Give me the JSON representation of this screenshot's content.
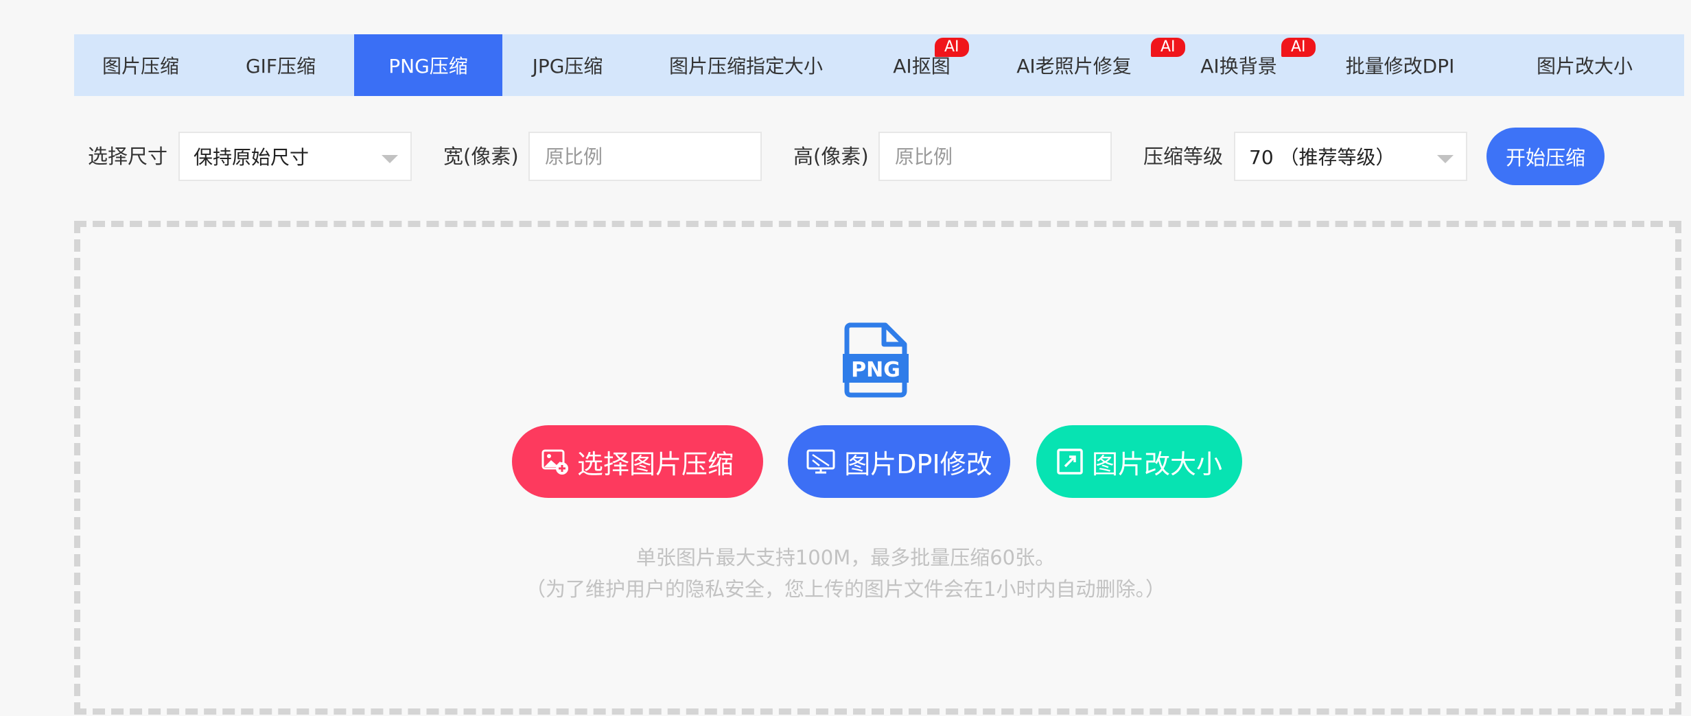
{
  "tabs": [
    {
      "label": "图片压缩",
      "active": false,
      "ai": false
    },
    {
      "label": "GIF压缩",
      "active": false,
      "ai": false
    },
    {
      "label": "PNG压缩",
      "active": true,
      "ai": false
    },
    {
      "label": "JPG压缩",
      "active": false,
      "ai": false
    },
    {
      "label": "图片压缩指定大小",
      "active": false,
      "ai": false
    },
    {
      "label": "AI抠图",
      "active": false,
      "ai": true
    },
    {
      "label": "AI老照片修复",
      "active": false,
      "ai": true
    },
    {
      "label": "AI换背景",
      "active": false,
      "ai": true
    },
    {
      "label": "批量修改DPI",
      "active": false,
      "ai": false
    },
    {
      "label": "图片改大小",
      "active": false,
      "ai": false
    }
  ],
  "ai_badge": "AI",
  "controls": {
    "size_label": "选择尺寸",
    "size_value": "保持原始尺寸",
    "width_label": "宽(像素)",
    "width_placeholder": "原比例",
    "height_label": "高(像素)",
    "height_placeholder": "原比例",
    "level_label": "压缩等级",
    "level_value": "70 （推荐等级）",
    "start_button": "开始压缩"
  },
  "dropzone": {
    "file_icon_text": "PNG",
    "select_button": "选择图片压缩",
    "dpi_button": "图片DPI修改",
    "resize_button": "图片改大小",
    "hint_line1": "单张图片最大支持100M，最多批量压缩60张。",
    "hint_line2": "（为了维护用户的隐私安全，您上传的图片文件会在1小时内自动删除。）"
  },
  "colors": {
    "active_tab": "#3a6ff5",
    "tabbar_bg": "#d5e6fb",
    "ai_badge": "#f0151b",
    "select_button": "#fd3a5e",
    "dpi_button": "#3c6ff5",
    "resize_button": "#07e3b2",
    "png_icon": "#2f7de9"
  }
}
